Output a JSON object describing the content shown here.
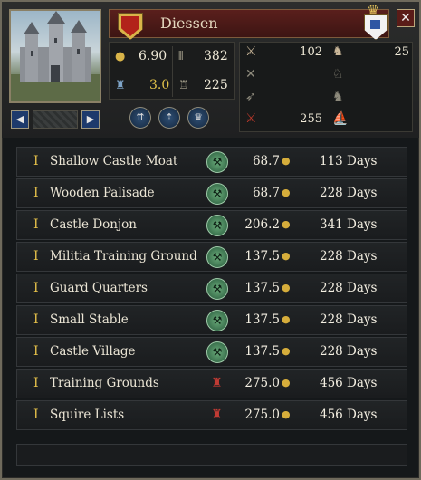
{
  "header": {
    "title": "Diessen",
    "close_label": "✕"
  },
  "stats": {
    "gold": "6.90",
    "levy": "382",
    "tech": "3.0",
    "garrison": "225"
  },
  "troops": [
    {
      "icon": "light-infantry-icon",
      "value": "102"
    },
    {
      "icon": "heavy-infantry-icon",
      "value": "25"
    },
    {
      "icon": "pikemen-icon",
      "value": ""
    },
    {
      "icon": "light-cavalry-icon",
      "value": ""
    },
    {
      "icon": "archers-icon",
      "value": ""
    },
    {
      "icon": "knights-icon",
      "value": ""
    },
    {
      "icon": "total-troops-icon",
      "value": "255"
    },
    {
      "icon": "ships-icon",
      "value": ""
    }
  ],
  "buildings": [
    {
      "num": "I",
      "name": "Shallow Castle Moat",
      "status": "build",
      "cost": "68.7",
      "days": "113 Days"
    },
    {
      "num": "I",
      "name": "Wooden Palisade",
      "status": "build",
      "cost": "68.7",
      "days": "228 Days"
    },
    {
      "num": "I",
      "name": "Castle Donjon",
      "status": "build",
      "cost": "206.2",
      "days": "341 Days"
    },
    {
      "num": "I",
      "name": "Militia Training Ground",
      "status": "build",
      "cost": "137.5",
      "days": "228 Days"
    },
    {
      "num": "I",
      "name": "Guard Quarters",
      "status": "build",
      "cost": "137.5",
      "days": "228 Days"
    },
    {
      "num": "I",
      "name": "Small Stable",
      "status": "build",
      "cost": "137.5",
      "days": "228 Days"
    },
    {
      "num": "I",
      "name": "Castle Village",
      "status": "build",
      "cost": "137.5",
      "days": "228 Days"
    },
    {
      "num": "I",
      "name": "Training Grounds",
      "status": "locked",
      "cost": "275.0",
      "days": "456 Days"
    },
    {
      "num": "I",
      "name": "Squire Lists",
      "status": "locked",
      "cost": "275.0",
      "days": "456 Days"
    }
  ]
}
